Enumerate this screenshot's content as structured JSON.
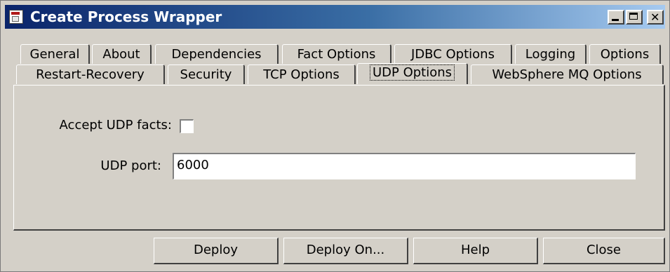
{
  "window": {
    "title": "Create Process Wrapper"
  },
  "tabs": {
    "row1": [
      "General",
      "About",
      "Dependencies",
      "Fact Options",
      "JDBC Options",
      "Logging",
      "Options"
    ],
    "row2": [
      "Restart-Recovery",
      "Security",
      "TCP Options",
      "UDP Options",
      "WebSphere MQ Options"
    ],
    "active": "UDP Options"
  },
  "udp": {
    "accept_label": "Accept UDP facts:",
    "accept_checked": false,
    "port_label": "UDP port:",
    "port_value": "6000"
  },
  "buttons": {
    "deploy": "Deploy",
    "deploy_on": "Deploy On...",
    "help": "Help",
    "close": "Close"
  }
}
